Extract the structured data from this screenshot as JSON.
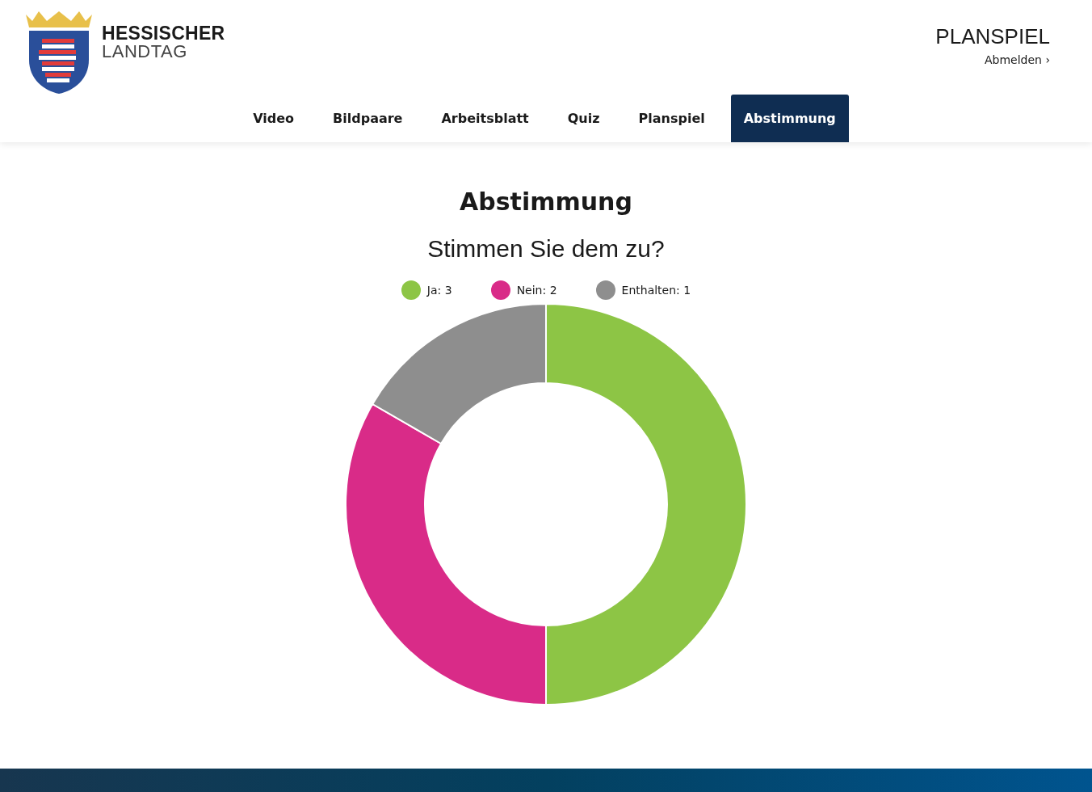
{
  "header": {
    "logo": {
      "line_1": "HESSISCHER",
      "line_2": "LANDTAG"
    },
    "section": "PLANSPIEL",
    "logout": "Abmelden ›"
  },
  "tabs": [
    {
      "label": "Video",
      "selected": false
    },
    {
      "label": "Bildpaare",
      "selected": false
    },
    {
      "label": "Arbeitsblatt",
      "selected": false
    },
    {
      "label": "Quiz",
      "selected": false
    },
    {
      "label": "Planspiel",
      "selected": false
    },
    {
      "label": "Abstimmung",
      "selected": true
    }
  ],
  "main": {
    "title": "Abstimmung",
    "question": "Stimmen Sie dem zu?",
    "legend": [
      {
        "color": "#8dc545"
      },
      {
        "color": "#d92b88"
      },
      {
        "color": "#8e8e8e"
      }
    ],
    "chart_data": {
      "type": "donut",
      "categories": [
        "Ja: 3",
        "Nein: 2",
        "Enthalten: 1"
      ],
      "values": [
        3,
        2,
        1
      ]
    }
  }
}
